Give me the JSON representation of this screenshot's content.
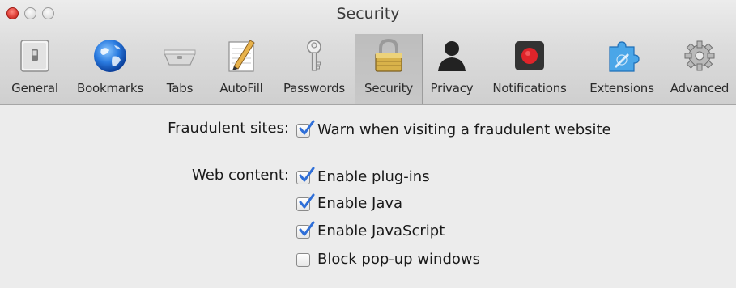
{
  "window": {
    "title": "Security"
  },
  "toolbar": {
    "tabs": [
      {
        "label": "General",
        "icon": "general-switch-icon"
      },
      {
        "label": "Bookmarks",
        "icon": "globe-icon"
      },
      {
        "label": "Tabs",
        "icon": "tabs-icon"
      },
      {
        "label": "AutoFill",
        "icon": "autofill-pencil-icon"
      },
      {
        "label": "Passwords",
        "icon": "key-icon"
      },
      {
        "label": "Security",
        "icon": "lock-icon",
        "selected": true
      },
      {
        "label": "Privacy",
        "icon": "person-silhouette-icon"
      },
      {
        "label": "Notifications",
        "icon": "record-icon"
      },
      {
        "label": "Extensions",
        "icon": "extensions-puzzle-icon"
      },
      {
        "label": "Advanced",
        "icon": "gears-icon"
      }
    ]
  },
  "settings": {
    "fraudulent": {
      "label": "Fraudulent sites:",
      "options": [
        {
          "label": "Warn when visiting a fraudulent website",
          "checked": true
        }
      ]
    },
    "web_content": {
      "label": "Web content:",
      "options": [
        {
          "label": "Enable plug-ins",
          "checked": true
        },
        {
          "label": "Enable Java",
          "checked": true
        },
        {
          "label": "Enable JavaScript",
          "checked": true
        },
        {
          "label": "Block pop-up windows",
          "checked": false
        }
      ]
    }
  },
  "colors": {
    "check_blue": "#2f6fd8",
    "close_button": "#e0423a",
    "selected_tab_bg": "#c2c2c2"
  }
}
